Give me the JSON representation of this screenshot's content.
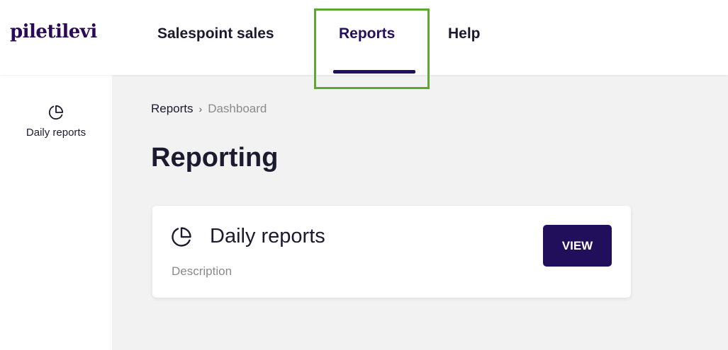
{
  "brand": {
    "logo": "piletilevi"
  },
  "nav": {
    "items": [
      {
        "label": "Salespoint sales",
        "active": false
      },
      {
        "label": "Reports",
        "active": true
      },
      {
        "label": "Help",
        "active": false
      }
    ]
  },
  "sidebar": {
    "items": [
      {
        "label": "Daily reports",
        "icon": "pie-chart-icon"
      }
    ]
  },
  "breadcrumb": {
    "items": [
      {
        "label": "Reports"
      },
      {
        "label": "Dashboard"
      }
    ],
    "separator": "›"
  },
  "page": {
    "title": "Reporting"
  },
  "cards": [
    {
      "title": "Daily reports",
      "description": "Description",
      "button_label": "VIEW",
      "icon": "pie-chart-icon"
    }
  ],
  "colors": {
    "brand": "#2a0a56",
    "primary_button": "#220f5c",
    "highlight": "#5ca832",
    "background": "#f2f2f2"
  }
}
